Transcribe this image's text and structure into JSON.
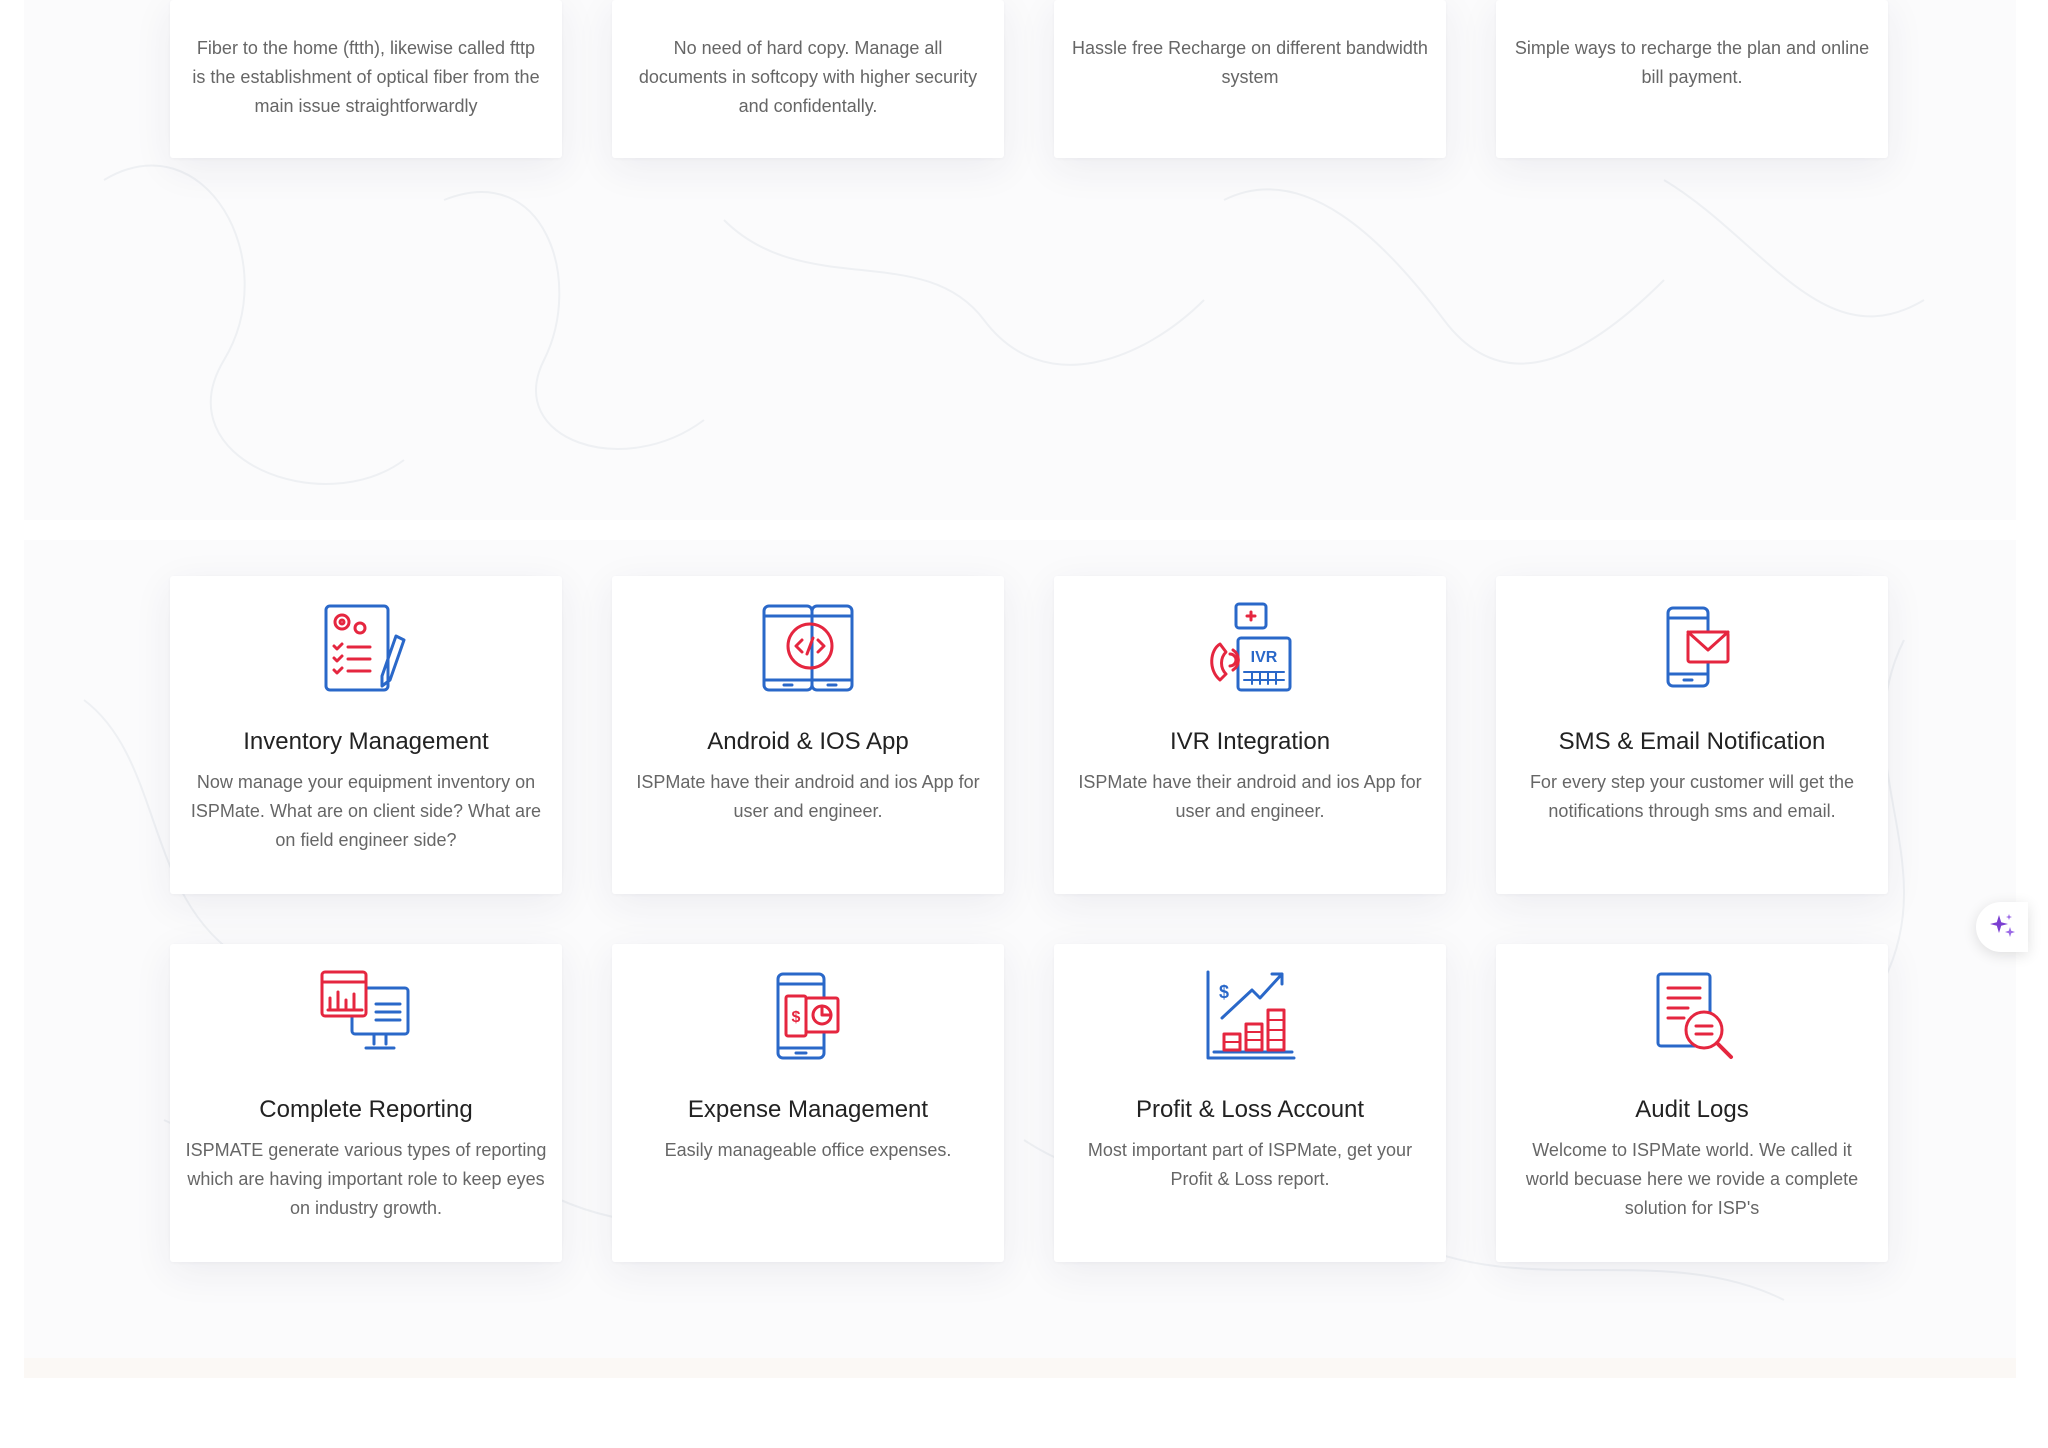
{
  "top_cards": [
    {
      "description": "Fiber to the home (ftth), likewise called fttp is the establishment of optical fiber from the main issue straightforwardly"
    },
    {
      "description": "No need of hard copy. Manage all documents in softcopy with higher security and confidentally."
    },
    {
      "description": "Hassle free Recharge on different bandwidth system"
    },
    {
      "description": "Simple ways to recharge the plan and online bill payment."
    }
  ],
  "features": [
    {
      "icon": "inventory-icon",
      "title": "Inventory Management",
      "description": "Now manage your equipment inventory on ISPMate. What are on client side? What are on field engineer side?"
    },
    {
      "icon": "mobile-app-icon",
      "title": "Android & IOS App",
      "description": "ISPMate have their android and ios App for user and engineer."
    },
    {
      "icon": "ivr-icon",
      "title": "IVR Integration",
      "description": "ISPMate have their android and ios App for user and engineer."
    },
    {
      "icon": "sms-email-icon",
      "title": "SMS & Email Notification",
      "description": "For every step your customer will get the notifications through sms and email."
    },
    {
      "icon": "reporting-icon",
      "title": "Complete Reporting",
      "description": "ISPMATE generate various types of reporting which are having important role to keep eyes on industry growth."
    },
    {
      "icon": "expense-icon",
      "title": "Expense Management",
      "description": "Easily manageable office expenses."
    },
    {
      "icon": "profit-loss-icon",
      "title": "Profit & Loss Account",
      "description": "Most important part of ISPMate, get your Profit & Loss report."
    },
    {
      "icon": "audit-logs-icon",
      "title": "Audit Logs",
      "description": "Welcome to ISPMate world. We called it world becuase here we rovide a complete solution for ISP's"
    }
  ],
  "colors": {
    "blue": "#2a68c9",
    "red": "#e5263f",
    "ai_purple": "#7b3fd1"
  }
}
